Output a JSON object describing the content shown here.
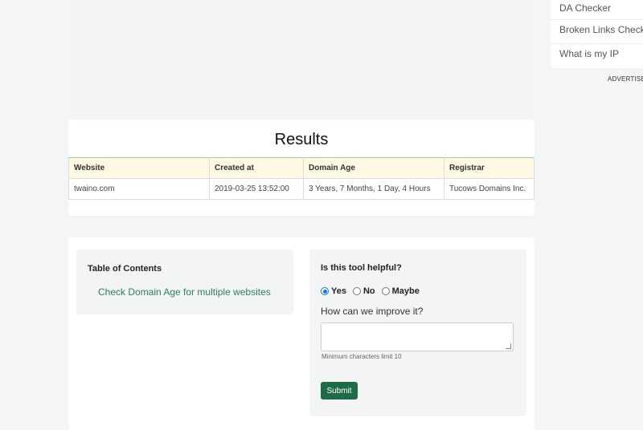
{
  "sidebar": {
    "items": [
      {
        "label": "DA Checker"
      },
      {
        "label": "Broken Links Checker"
      },
      {
        "label": "What is my IP"
      }
    ],
    "ad_label": "ADVERTISEMENT"
  },
  "results": {
    "title": "Results",
    "columns": [
      "Website",
      "Created at",
      "Domain Age",
      "Registrar"
    ],
    "rows": [
      [
        "twaino.com",
        "2019-03-25 13:52:00",
        "3 Years, 7 Months, 1 Day, 4 Hours",
        "Tucows Domains Inc."
      ]
    ]
  },
  "toc": {
    "title": "Table of Contents",
    "link": "Check Domain Age for multiple websites"
  },
  "feedback": {
    "question": "Is this tool helpful?",
    "options": [
      {
        "label": "Yes",
        "checked": true
      },
      {
        "label": "No",
        "checked": false
      },
      {
        "label": "Maybe",
        "checked": false
      }
    ],
    "improve_label": "How can we improve it?",
    "textarea_value": "",
    "hint": "Minimum characters limit 10",
    "submit_label": "Submit"
  },
  "colors": {
    "accent": "#1f6b47",
    "link": "#2e7d5b",
    "table_header_bg": "#fff9e3",
    "radio_checked": "#0d6efd"
  }
}
